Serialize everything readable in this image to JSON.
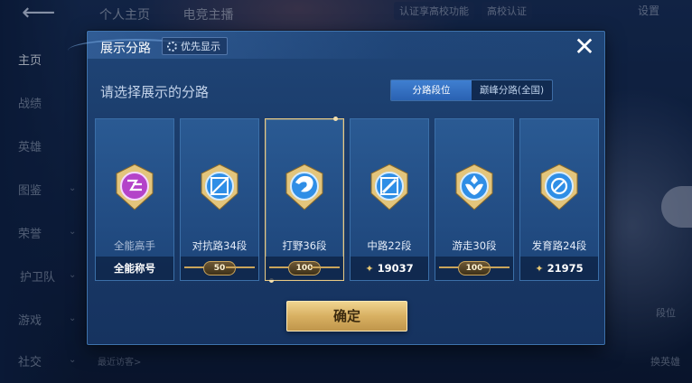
{
  "background": {
    "nav": [
      {
        "label": "主页",
        "active": true
      },
      {
        "label": "战绩"
      },
      {
        "label": "英雄"
      },
      {
        "label": "图鉴"
      },
      {
        "label": "荣誉"
      },
      {
        "label": "护卫队"
      },
      {
        "label": "游戏"
      },
      {
        "label": "社交"
      }
    ],
    "top_tabs": [
      "个人主页",
      "电竞主播"
    ],
    "verify_text": "认证享高校功能",
    "campus_badge": "高校认证",
    "settings_label": "设置",
    "visitors_label": "最近访客>",
    "rank_label": "段位",
    "switch_hero_label": "换英雄"
  },
  "dialog": {
    "title": "展示分路",
    "priority_label": "优先显示",
    "subtitle": "请选择展示的分路",
    "tabs": [
      {
        "label": "分路段位",
        "active": true
      },
      {
        "label": "巅峰分路(全国)",
        "active": false
      }
    ],
    "cards": [
      {
        "label": "全能高手",
        "bottom_text": "全能称号",
        "bottom_type": "text",
        "emblem": "all-round-emblem-icon",
        "emblem_color": "#b443c9"
      },
      {
        "label": "对抗路34段",
        "bottom_text": "50",
        "bottom_type": "badge",
        "emblem": "clash-lane-emblem-icon",
        "emblem_color": "#2f8ee6"
      },
      {
        "label": "打野36段",
        "bottom_text": "100",
        "bottom_type": "badge",
        "emblem": "jungle-emblem-icon",
        "emblem_color": "#2f8ee6",
        "selected": true
      },
      {
        "label": "中路22段",
        "bottom_text": "19037",
        "bottom_type": "star",
        "emblem": "mid-lane-emblem-icon",
        "emblem_color": "#2f8ee6"
      },
      {
        "label": "游走30段",
        "bottom_text": "100",
        "bottom_type": "badge",
        "emblem": "roam-emblem-icon",
        "emblem_color": "#2f8ee6"
      },
      {
        "label": "发育路24段",
        "bottom_text": "21975",
        "bottom_type": "star",
        "emblem": "farm-lane-emblem-icon",
        "emblem_color": "#2f8ee6"
      }
    ],
    "confirm_label": "确定",
    "close_icon": "close-icon"
  }
}
